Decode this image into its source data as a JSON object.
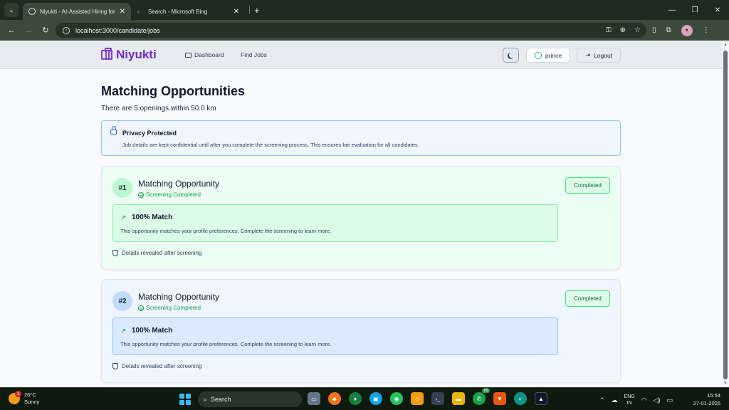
{
  "browser": {
    "tabs": [
      {
        "title": "Niyukti - AI-Assisted Hiring for",
        "active": true
      },
      {
        "title": "Search - Microsoft Bing",
        "active": false
      }
    ],
    "url": "localhost:3000/candidate/jobs"
  },
  "app": {
    "brand": "Niyukti",
    "nav": {
      "dashboard": "Dashboard",
      "find_jobs": "Find Jobs"
    },
    "user_name": "prince",
    "logout": "Logout"
  },
  "main": {
    "title": "Matching Opportunities",
    "subtitle": "There are 5 openings within 50.0 km",
    "privacy": {
      "title": "Privacy Protected",
      "text": "Job details are kept confidential until after you complete the screening process. This ensures fair evaluation for all candidates."
    },
    "cards": [
      {
        "rank": "#1",
        "title": "Matching Opportunity",
        "status": "Screening Completed",
        "badge": "Completed",
        "match": "100% Match",
        "match_text": "This opportunity matches your profile preferences. Complete the screening to learn more.",
        "details": "Details revealed after screening"
      },
      {
        "rank": "#2",
        "title": "Matching Opportunity",
        "status": "Screening Completed",
        "badge": "Completed",
        "match": "100% Match",
        "match_text": "This opportunity matches your profile preferences. Complete the screening to learn more.",
        "details": "Details revealed after screening"
      }
    ]
  },
  "taskbar": {
    "weather_temp": "26°C",
    "weather_cond": "Sunny",
    "weather_alert": "3",
    "search": "Search",
    "whatsapp_badge": "99",
    "lang_top": "ENG",
    "lang_bottom": "IN",
    "time": "15:54",
    "date": "27-01-2026"
  },
  "colors": {
    "brand": "#6d28d9",
    "success": "#16a34a",
    "privacy_border": "#93c5fd"
  }
}
